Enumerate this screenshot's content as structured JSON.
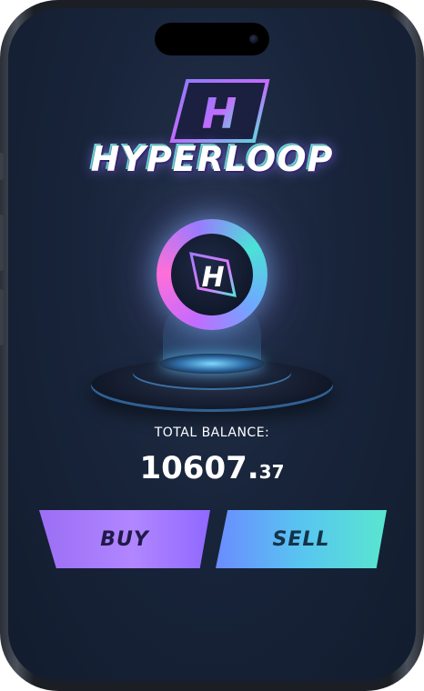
{
  "app": {
    "logo_text": "HYPERLOOP"
  },
  "wallet": {
    "balance_label": "TOTAL BALANCE:",
    "balance_integer": "10607.",
    "balance_decimal": "37"
  },
  "actions": {
    "buy_label": "BUY",
    "sell_label": "SELL"
  },
  "colors": {
    "accent_purple": "#9b6ef4",
    "accent_cyan": "#59e6cf",
    "background": "#18243a"
  },
  "icons": {
    "logo_emblem": "h-emblem-icon",
    "coin_emblem": "coin-h-icon"
  }
}
